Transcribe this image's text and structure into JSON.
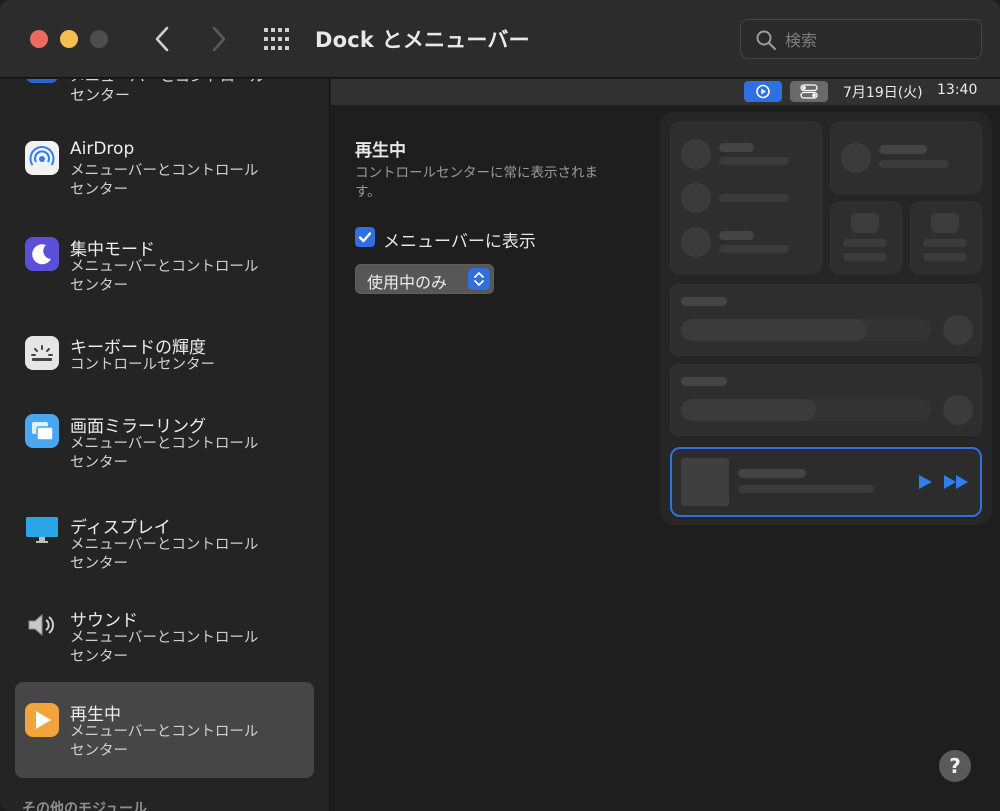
{
  "window": {
    "title": "Dock とメニューバー",
    "search_placeholder": "検索"
  },
  "sidebar": {
    "cut_item": {
      "label": "メニューバーとコントロール\nセンター"
    },
    "items": [
      {
        "title": "AirDrop",
        "subtitle": "メニューバーとコントロール\nセンター",
        "icon": "airdrop-icon"
      },
      {
        "title": "集中モード",
        "subtitle": "メニューバーとコントロール\nセンター",
        "icon": "focus-moon-icon"
      },
      {
        "title": "キーボードの輝度",
        "subtitle": "コントロールセンター",
        "icon": "keyboard-brightness-icon"
      },
      {
        "title": "画面ミラーリング",
        "subtitle": "メニューバーとコントロール\nセンター",
        "icon": "screen-mirroring-icon"
      },
      {
        "title": "ディスプレイ",
        "subtitle": "メニューバーとコントロール\nセンター",
        "icon": "display-icon"
      },
      {
        "title": "サウンド",
        "subtitle": "メニューバーとコントロール\nセンター",
        "icon": "speaker-icon"
      },
      {
        "title": "再生中",
        "subtitle": "メニューバーとコントロール\nセンター",
        "icon": "now-playing-icon",
        "selected": true
      }
    ],
    "section_label": "その他のモジュール"
  },
  "menubar_preview": {
    "date": "7月19日(火)",
    "time": "13:40"
  },
  "detail": {
    "title": "再生中",
    "description": "コントロールセンターに常に表示されます。",
    "show_in_menubar_label": "メニューバーに表示",
    "show_in_menubar_checked": true,
    "visibility_select_value": "使用中のみ"
  },
  "help": {
    "label": "?"
  },
  "colors": {
    "accent": "#2f6fe0",
    "selected_row": "#464646"
  }
}
